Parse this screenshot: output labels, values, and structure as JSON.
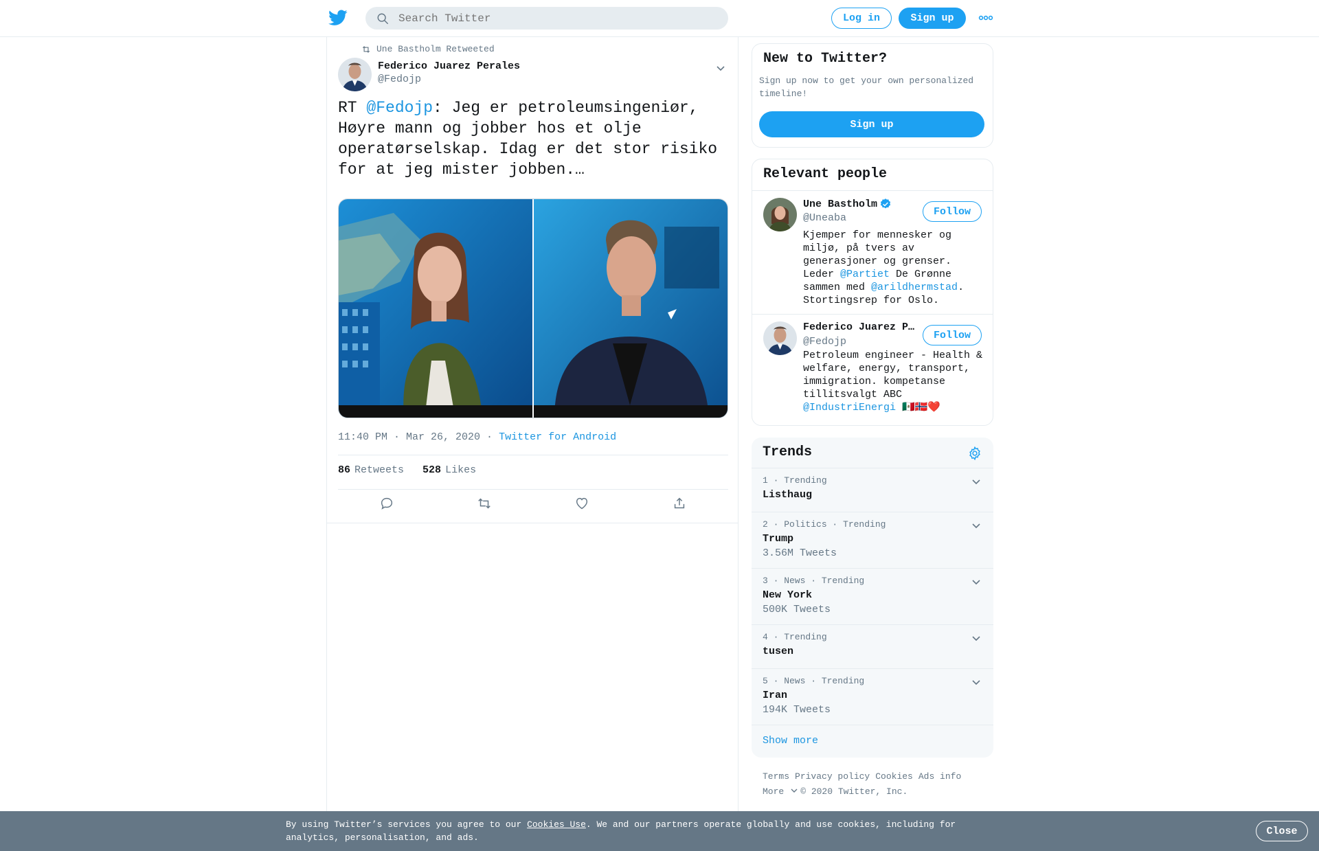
{
  "header": {
    "search_placeholder": "Search Twitter",
    "login_label": "Log in",
    "signup_label": "Sign up"
  },
  "tweet": {
    "retweeted_by": "Une Bastholm Retweeted",
    "author_name": "Federico Juarez Perales",
    "author_handle": "@Fedojp",
    "text_prefix": "RT ",
    "text_mention": "@Fedojp",
    "text_body": ": Jeg er petroleumsingeniør, Høyre mann og jobber hos et olje operatørselskap. Idag er det stor risiko for at jeg mister jobben.…",
    "timestamp": "11:40 PM · Mar 26, 2020",
    "separator": " · ",
    "source": "Twitter for Android",
    "retweets_count": "86",
    "retweets_label": "Retweets",
    "likes_count": "528",
    "likes_label": "Likes"
  },
  "new_to_twitter": {
    "title": "New to Twitter?",
    "subtitle": "Sign up now to get your own personalized timeline!",
    "button": "Sign up"
  },
  "relevant_people": {
    "title": "Relevant people",
    "people": [
      {
        "name": "Une Bastholm",
        "handle": "@Uneaba",
        "follow": "Follow",
        "bio_1": "Kjemper for mennesker og miljø, på tvers av generasjoner og grenser. Leder ",
        "bio_link_1": "@Partiet",
        "bio_2": " De Grønne sammen med ",
        "bio_link_2": "@arildhermstad",
        "bio_3": ". Stortingsrep for Oslo."
      },
      {
        "name": "Federico Juarez P…",
        "handle": "@Fedojp",
        "follow": "Follow",
        "bio_1": "Petroleum engineer - Health & welfare, energy, transport, immigration. kompetanse tillitsvalgt ABC ",
        "bio_link_1": "@IndustriEnergi",
        "bio_2": " 🇲🇽🇳🇴❤️"
      }
    ]
  },
  "trends": {
    "title": "Trends",
    "items": [
      {
        "context": "1 · Trending",
        "name": "Listhaug",
        "count": ""
      },
      {
        "context": "2 · Politics · Trending",
        "name": "Trump",
        "count": "3.56M Tweets"
      },
      {
        "context": "3 · News · Trending",
        "name": "New York",
        "count": "500K Tweets"
      },
      {
        "context": "4 · Trending",
        "name": "tusen",
        "count": ""
      },
      {
        "context": "5 · News · Trending",
        "name": "Iran",
        "count": "194K Tweets"
      }
    ],
    "show_more": "Show more"
  },
  "footer": {
    "terms": "Terms",
    "privacy": "Privacy policy",
    "cookies": "Cookies",
    "ads": "Ads info",
    "more": "More",
    "copyright": "© 2020 Twitter, Inc."
  },
  "cookie_banner": {
    "text_1": "By using Twitter’s services you agree to our ",
    "link": "Cookies Use",
    "text_2": ". We and our partners operate globally and use cookies, including for analytics, personalisation, and ads.",
    "close": "Close"
  },
  "colors": {
    "accent": "#1da1f2",
    "link": "#1b95e0",
    "muted": "#657786",
    "banner": "#657786"
  }
}
